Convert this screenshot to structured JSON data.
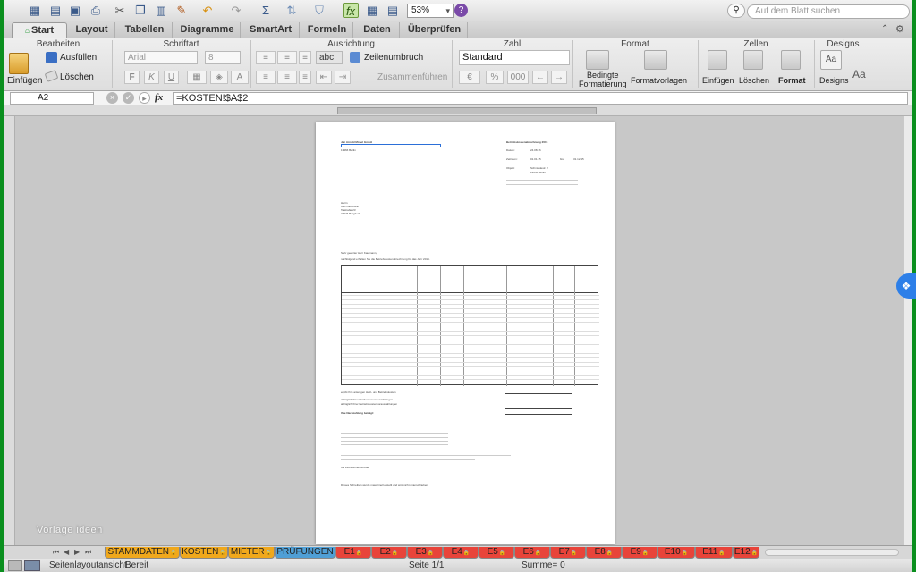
{
  "toolbar": {
    "zoom": "53%",
    "search_placeholder": "Auf dem Blatt suchen"
  },
  "tabs": [
    "Start",
    "Layout",
    "Tabellen",
    "Diagramme",
    "SmartArt",
    "Formeln",
    "Daten",
    "Überprüfen"
  ],
  "ribbon": {
    "groups": {
      "bearbeiten": "Bearbeiten",
      "schriftart": "Schriftart",
      "ausrichtung": "Ausrichtung",
      "zahl": "Zahl",
      "format": "Format",
      "zellen": "Zellen",
      "designs": "Designs"
    },
    "einfuegen": "Einfügen",
    "ausfuellen": "Ausfüllen",
    "loeschen": "Löschen",
    "font_name": "Arial",
    "font_size": "8",
    "bold": "F",
    "italic": "K",
    "underline": "U",
    "text_style": "abc",
    "zeilenumbruch": "Zeilenumbruch",
    "zusammenfuehren": "Zusammenführen",
    "number_format": "Standard",
    "percent": "%",
    "thousands": "000",
    "bedingte": "Bedingte",
    "formatierung": "Formatierung",
    "formatvorlagen": "Formatvorlagen",
    "zellen_einfuegen": "Einfügen",
    "zellen_loeschen": "Löschen",
    "zellen_format": "Format",
    "designs": "Designs",
    "aa": "Aa"
  },
  "formula_bar": {
    "cell": "A2",
    "fx": "fx",
    "formula": "=KOSTEN!$A$2"
  },
  "document": {
    "company": "Jan Arnold Möbel GmbH",
    "company_city": "13466 Berlin",
    "doc_title": "Betriebskostenabrechnung 2015",
    "date_label": "Datum:",
    "date": "24.08.16",
    "period_label": "Zeitraum:",
    "period_from": "01.01.15",
    "period_to_label": "bis",
    "period_to": "31.12.15",
    "object_label": "Objekt:",
    "object": "Schmiedestr. 2",
    "object_city": "12045 Berlin",
    "recipient_1": "Herrn",
    "recipient_2": "Max Kaufmann",
    "recipient_3": "Talstraße 23",
    "recipient_4": "34626 Bergdorf",
    "salutation": "Sehr geehrter Herr Kaufmann,",
    "intro": "nachfolgend erhalten Sie die Betriebskostenabrechnung für das Jahr 2015.",
    "summary_1": "ergibt Ihre anteiligen Heiz- und Betriebskosten",
    "summary_2": "abzüglich Ihrer Heizkostenvorauszahlungen",
    "summary_3": "abzüglich Ihrer Betriebskostenvorauszahlungen",
    "result_label": "Ihre Nachzahlung beträgt:",
    "closing": "Mit freundlichen Grüßen",
    "footer": "Dieses Schreiben wurde maschinell erstellt und wird nicht unterschrieben."
  },
  "watermark": "Vorlage ideen",
  "sheet_tabs": [
    {
      "label": "STAMMDATEN",
      "color": "#f0a81c"
    },
    {
      "label": "KOSTEN",
      "color": "#f0a81c"
    },
    {
      "label": "MIETER",
      "color": "#f0a81c"
    },
    {
      "label": "PRÜFUNGEN",
      "color": "#4f9fd6"
    },
    {
      "label": "E1",
      "color": "#e8443a"
    },
    {
      "label": "E2",
      "color": "#e8443a"
    },
    {
      "label": "E3",
      "color": "#e8443a"
    },
    {
      "label": "E4",
      "color": "#e8443a"
    },
    {
      "label": "E5",
      "color": "#e8443a"
    },
    {
      "label": "E6",
      "color": "#e8443a"
    },
    {
      "label": "E7",
      "color": "#e8443a"
    },
    {
      "label": "E8",
      "color": "#e8443a"
    },
    {
      "label": "E9",
      "color": "#e8443a"
    },
    {
      "label": "E10",
      "color": "#e8443a"
    },
    {
      "label": "E11",
      "color": "#e8443a"
    },
    {
      "label": "E12",
      "color": "#e8443a"
    }
  ],
  "status": {
    "view": "Seitenlayoutansicht",
    "ready": "Bereit",
    "page": "Seite 1/1",
    "sum": "Summe= 0"
  }
}
